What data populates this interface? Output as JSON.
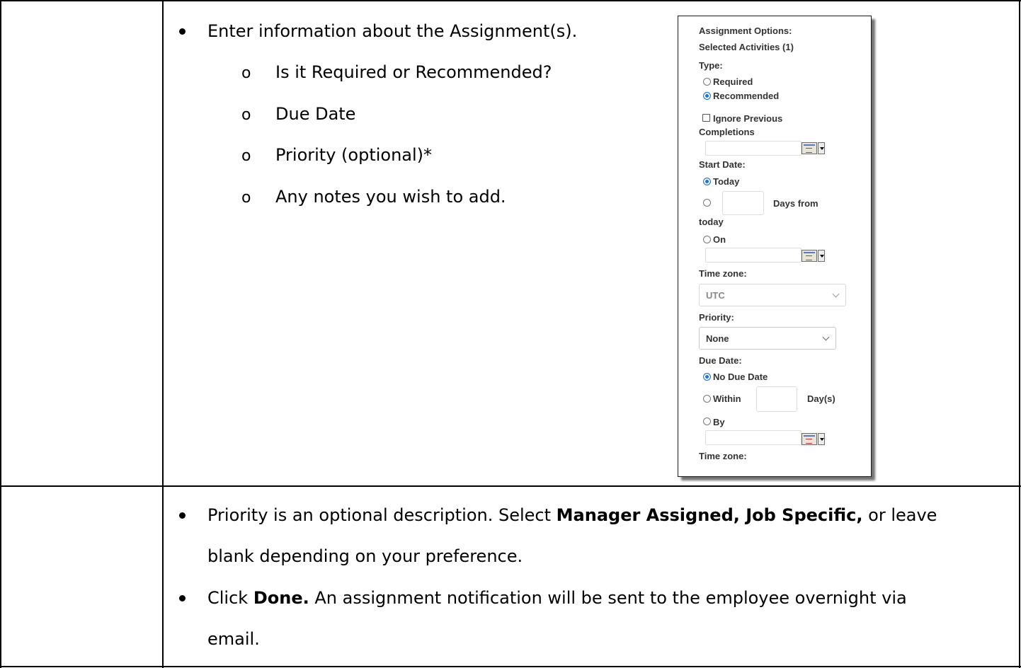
{
  "row1": {
    "bullet_text": "Enter information about the Assignment(s).",
    "sub_items": [
      "Is it Required or Recommended?",
      "Due Date",
      "Priority (optional)*",
      "Any notes you wish to add."
    ],
    "sub_marker": "o"
  },
  "panel": {
    "heading": "Assignment Options:",
    "selected_activities": "Selected Activities (1)",
    "type_label": "Type:",
    "required_label": "Required",
    "recommended_label": "Recommended",
    "ignore_previous_line1": "Ignore Previous",
    "ignore_previous_line2": "Completions",
    "start_date_label": "Start Date:",
    "today_label": "Today",
    "days_from_label": "Days from",
    "today_wrap": "today",
    "on_label": "On",
    "time_zone_label": "Time zone:",
    "time_zone_value": "UTC",
    "priority_label": "Priority:",
    "priority_value": "None",
    "due_date_label": "Due Date:",
    "no_due_date_label": "No Due Date",
    "within_label": "Within",
    "days_label": "Day(s)",
    "by_label": "By",
    "time_zone_label_2": "Time zone:",
    "selected_type": "Recommended",
    "selected_start": "Today",
    "selected_due": "No Due Date"
  },
  "row2": {
    "bullet1_line1_pre": "Priority is an optional description. Select ",
    "bullet1_line1_bold": "Manager Assigned, Job Specific,",
    "bullet1_line1_post": " or leave",
    "bullet1_line2": "blank depending on your preference.",
    "bullet2_line1_pre": "Click ",
    "bullet2_line1_bold": "Done.",
    "bullet2_line1_post": " An assignment notification will be sent to the employee overnight via",
    "bullet2_line2": "email."
  }
}
